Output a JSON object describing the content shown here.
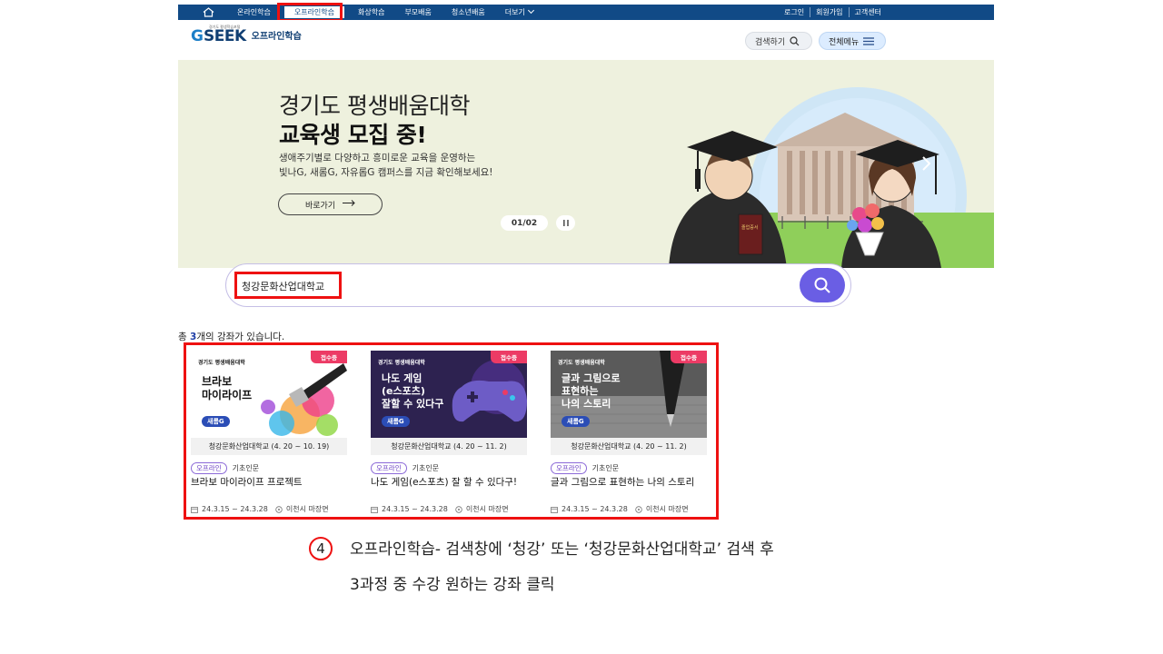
{
  "topbar": {
    "nav": [
      "온라인학습",
      "오프라인학습",
      "화상학습",
      "부모배움",
      "청소년배움",
      "더보기"
    ],
    "active_index": 1,
    "links": [
      "로그인",
      "회원가입",
      "고객센터"
    ]
  },
  "header": {
    "logo_small": "경기도 평생학습포털",
    "logo_g": "G",
    "logo_seek": "SEEK",
    "logo_sub": "오프라인학습",
    "search_label": "검색하기",
    "menu_label": "전체메뉴"
  },
  "banner": {
    "title1": "경기도 평생배움대학",
    "title2": "교육생 모집 중!",
    "desc1": "생애주기별로 다양하고 흥미로운 교육을 운영하는",
    "desc2": "빛나G, 새롬G, 자유롭G 캠퍼스를 지금 확인해보세요!",
    "go_label": "바로가기",
    "pager": "01/02",
    "diploma_text": "졸업증서"
  },
  "search": {
    "value": "청강문화산업대학교"
  },
  "results": {
    "prefix": "총 ",
    "count": "3",
    "suffix": "개의 강좌가 있습니다.",
    "cards": [
      {
        "thumb_top": "경기도 평생배움대학",
        "thumb_title": "브라보\n마이라이프",
        "thumb_tag": "새롬G",
        "badge": "접수중",
        "caption": "청강문화산업대학교 (4. 20 ~ 10. 19)",
        "type": "오프라인",
        "category": "기초인문",
        "title": "브라보 마이라이프 프로젝트",
        "period": "24.3.15 ~ 24.3.28",
        "location": "이천시 마장면"
      },
      {
        "thumb_top": "경기도 평생배움대학",
        "thumb_title": "나도 게임\n(e스포츠)\n잘할 수 있다구",
        "thumb_tag": "새롬G",
        "badge": "접수중",
        "caption": "청강문화산업대학교 (4. 20 ~ 11. 2)",
        "type": "오프라인",
        "category": "기초인문",
        "title": "나도 게임(e스포츠) 잘 할 수 있다구!",
        "period": "24.3.15 ~ 24.3.28",
        "location": "이천시 마장면"
      },
      {
        "thumb_top": "경기도 평생배움대학",
        "thumb_title": "글과 그림으로\n표현하는\n나의 스토리",
        "thumb_tag": "새롬G",
        "badge": "접수중",
        "caption": "청강문화산업대학교 (4. 20 ~ 11. 2)",
        "type": "오프라인",
        "category": "기초인문",
        "title": "글과 그림으로 표현하는 나의 스토리",
        "period": "24.3.15 ~ 24.3.28",
        "location": "이천시 마장면"
      }
    ]
  },
  "instruction": {
    "step": "4",
    "line1": "오프라인학습- 검색창에 ‘청강’ 또는 ‘청강문화산업대학교’ 검색 후",
    "line2": "3과정 중 수강 원하는 강좌 클릭"
  },
  "colors": {
    "topbar": "#114a86",
    "accent": "#6a5ee4",
    "highlight": "#ee1111",
    "badge": "#ec3b65"
  }
}
